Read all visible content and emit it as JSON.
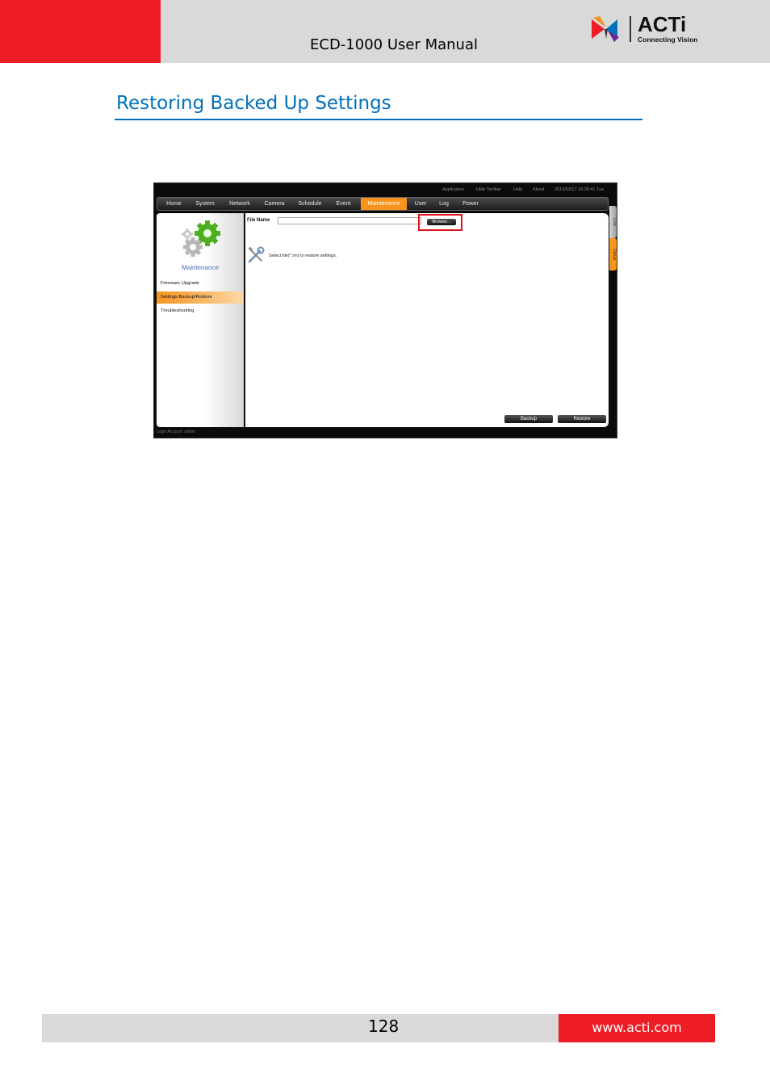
{
  "header": {
    "manual_title": "ECD-1000 User Manual",
    "logo_name": "ACTi",
    "logo_tagline": "Connecting Vision",
    "accent_red": "#ee1c25",
    "band_grey": "#d9d9d9"
  },
  "section": {
    "title": "Restoring Backed Up Settings",
    "color": "#0071bc"
  },
  "screenshot": {
    "topbar": [
      "Application",
      "Hide Toolbar",
      "Help",
      "About",
      "2013/03/17 18:39:41 Tue"
    ],
    "nav": [
      "Home",
      "System",
      "Network",
      "Camera",
      "Schedule",
      "Event",
      "Maintenance",
      "User",
      "Log",
      "Power"
    ],
    "active_nav": "Maintenance",
    "accent_orange": "#f7941d",
    "sidebar": {
      "title": "Maintenance",
      "items": [
        "Firmware Upgrade",
        "Settings Backup/Restore",
        "Troubleshooting"
      ]
    },
    "content": {
      "file_name_label": "File Name",
      "file_name_value": "",
      "browse_label": "Browse...",
      "help_text": "Select file(*.rm) to restore settings.",
      "backup_label": "Backup",
      "restore_label": "Restore"
    },
    "side_tabs": [
      "Live",
      "Setup"
    ],
    "status": "Login Account: admin"
  },
  "footer": {
    "page_number": "128",
    "url": "www.acti.com"
  }
}
